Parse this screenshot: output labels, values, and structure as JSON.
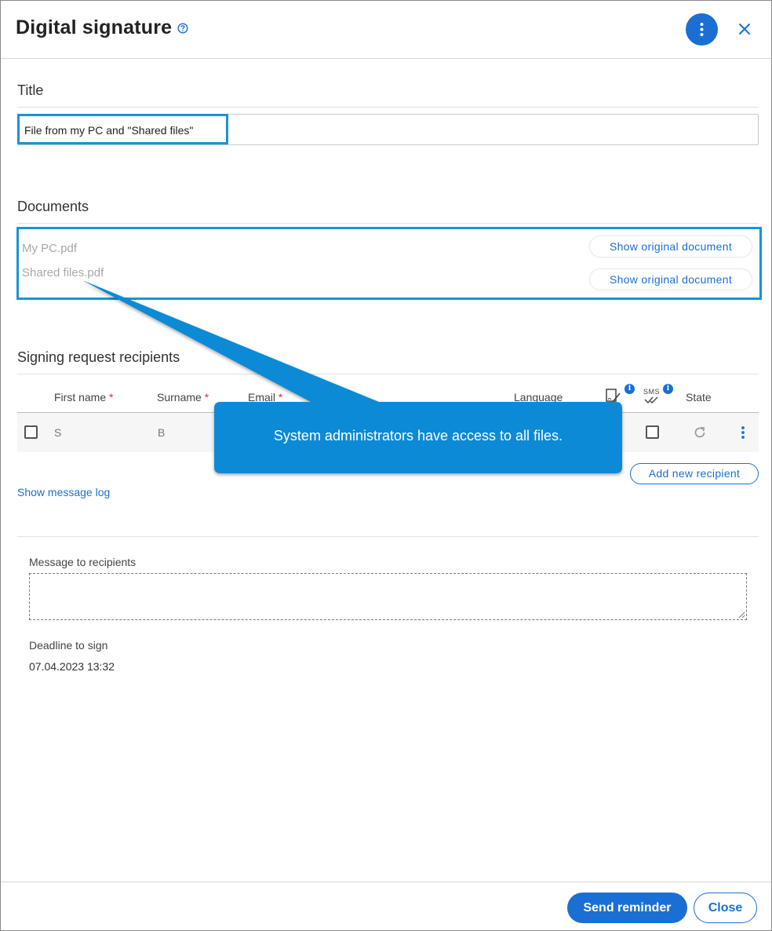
{
  "dialog": {
    "title": "Digital signature",
    "icons": {
      "help": "help-circle-icon",
      "more": "more-vertical-icon",
      "close": "close-icon"
    }
  },
  "title_section": {
    "label": "Title",
    "value": "File from my PC and \"Shared files\""
  },
  "documents_section": {
    "label": "Documents",
    "items": [
      {
        "name": "My PC.pdf",
        "button": "Show original document"
      },
      {
        "name": "Shared files.pdf",
        "button": "Show original document"
      }
    ]
  },
  "recipients_section": {
    "label": "Signing request recipients",
    "columns": {
      "first_name": "First name",
      "surname": "Surname",
      "email": "Email",
      "language": "Language",
      "sign_icon": "sign-pen-icon",
      "sms_icon": "sms-check-icon",
      "sms_text": "SMS",
      "state": "State",
      "required_mark": "*",
      "info_mark": "i"
    },
    "rows": [
      {
        "first_name": "S",
        "surname": "B"
      }
    ],
    "row_icons": {
      "refresh": "refresh-icon",
      "menu": "more-vertical-icon"
    },
    "add_button": "Add new recipient",
    "message_log_link": "Show message log"
  },
  "message": {
    "label": "Message to recipients",
    "value": ""
  },
  "deadline": {
    "label": "Deadline to sign",
    "value": "07.04.2023 13:32"
  },
  "footer": {
    "send_reminder": "Send reminder",
    "close": "Close"
  },
  "callout": {
    "text": "System administrators have access to all files."
  },
  "colors": {
    "accent": "#1a6fd4",
    "highlight": "#1a93d6",
    "callout": "#0a8ad6"
  }
}
